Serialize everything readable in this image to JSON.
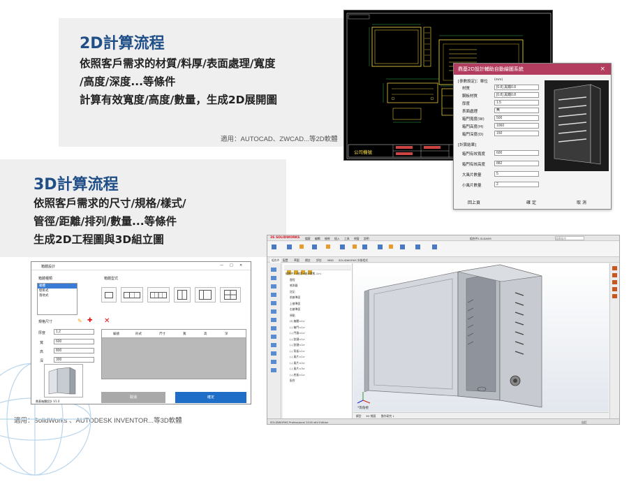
{
  "section2d": {
    "title": "2D計算流程",
    "line1": "依照客戶需求的材質/料厚/表面處理/寬度",
    "line2": "/高度/深度...等條件",
    "line3": "計算有效寬度/高度/數量，生成2D展開圖",
    "note": "適用：AUTOCAD、ZWCAD...等2D軟體"
  },
  "section3d": {
    "title": "3D計算流程",
    "line1": "依照客戶需求的尺寸/規格/樣式/",
    "line2": "管徑/距離/排列/數量...等條件",
    "line3": "生成2D工程圖與3D組立圖",
    "note": "適用：SolidWorks 、AUTODESK INVENTOR...等3D軟體"
  },
  "cad": {
    "company": "公司機號"
  },
  "dialog2d": {
    "title": "鼎基2D設計輔助自動繪圖系統",
    "close": "×",
    "param_header": "[參數設定]：單位",
    "unit": "(mm)",
    "fields": [
      {
        "label": "材質",
        "value": "[0.8] 黑鐵0.8"
      },
      {
        "label": "鋼板材質",
        "value": "[0.8] 黑鐵0.8"
      },
      {
        "label": "厚度",
        "value": "1.5"
      },
      {
        "label": "表面處理",
        "value": "無"
      },
      {
        "label": "箱門寬度(W)",
        "value": "500"
      },
      {
        "label": "箱門高度(H)",
        "value": "1060"
      },
      {
        "label": "箱門深度(D)",
        "value": "150"
      }
    ],
    "result_header": "[計算結果]",
    "results": [
      {
        "label": "箱門有效寬度",
        "value": "600"
      },
      {
        "label": "箱門有效高度",
        "value": "882"
      },
      {
        "label": "大風片數量",
        "value": "5"
      },
      {
        "label": "小風片數量",
        "value": "2"
      }
    ],
    "buttons": [
      "回上頁",
      "確 定",
      "取 消"
    ]
  },
  "app3d": {
    "window_title": "箱體設計",
    "window_controls": [
      "—",
      "□",
      "✕"
    ],
    "type_label": "箱體種類",
    "types": [
      "箱體",
      "壁掛式",
      "落地式"
    ],
    "style_label": "箱體型式",
    "size_label": "規格尺寸",
    "form_fields": [
      {
        "label": "厚度",
        "value": "1.2"
      },
      {
        "label": "寬",
        "value": "600"
      },
      {
        "label": "高",
        "value": "800"
      },
      {
        "label": "深",
        "value": "300"
      }
    ],
    "table_headers": [
      "編號",
      "形式",
      "尺寸",
      "寬",
      "高",
      "深"
    ],
    "btn_cancel": "取消",
    "btn_ok": "確定",
    "status": "鼎基箱體設計 V1.0"
  },
  "solidworks": {
    "logo": "3S SOLIDWORKS",
    "menus": [
      "檔案",
      "編輯",
      "檢視",
      "插入",
      "工具",
      "視窗",
      "說明"
    ],
    "doc_title": "組合件1.SLDASM",
    "search": "搜尋指令",
    "tabs": [
      "組合件",
      "配置",
      "草圖",
      "標註",
      "評估",
      "MBD",
      "SOLIDWORKS 外掛程式"
    ],
    "tree": [
      "組合件1 (預設<顯示狀態-1>)",
      "歷程",
      "感測器",
      "註記",
      "前基準面",
      "上基準面",
      "右基準面",
      "原點",
      "(f) 箱體<1>",
      "(-) 箱門<1>",
      "(-) 門鎖<1>",
      "(-) 鉸鏈<1>",
      "(-) 鉸鏈<2>",
      "(-) 背板<1>",
      "(-) 風片<1>",
      "(-) 風片<2>",
      "(-) 風片<3>",
      "(-) 底板<1>",
      "配合"
    ],
    "bottom_tabs": [
      "模型",
      "3D 視圖",
      "動作研究 1"
    ],
    "view_label": "*等角視",
    "status_left": "SOLIDWORKS Professional 2018 x64 Edition",
    "status_right": "自訂"
  }
}
